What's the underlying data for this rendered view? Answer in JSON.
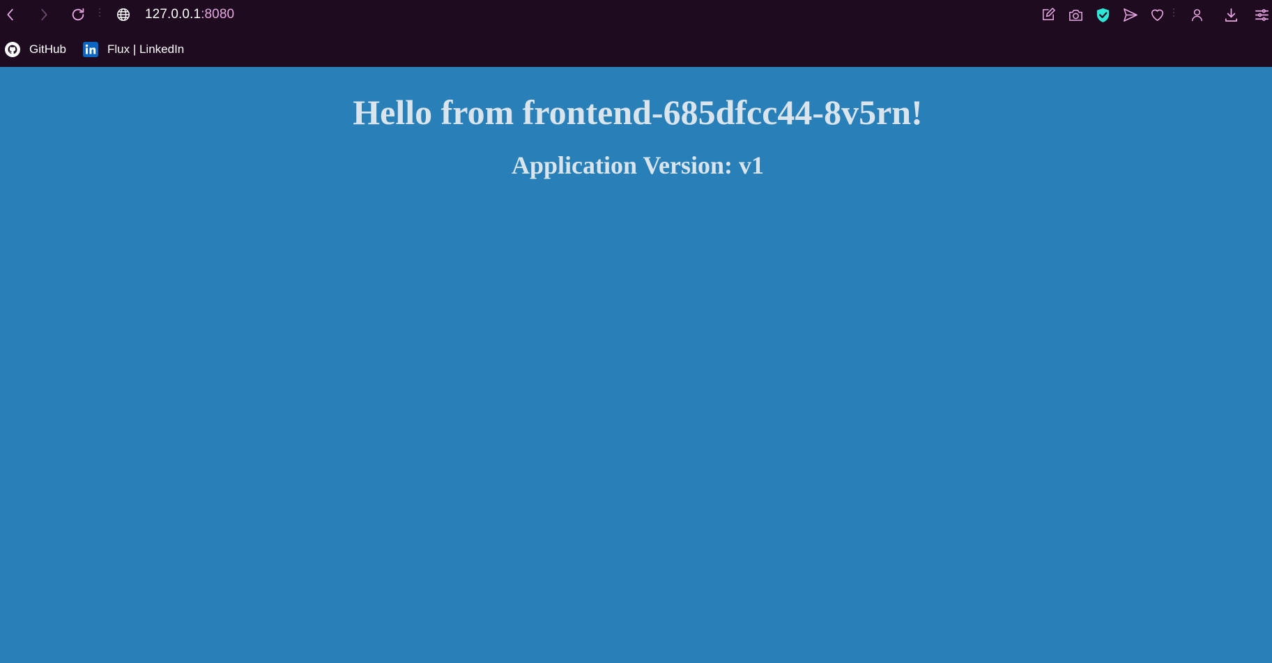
{
  "browser": {
    "url_host": "127.0.0.1",
    "url_port": ":8080",
    "bookmarks": [
      {
        "label": "GitHub",
        "icon": "github-icon"
      },
      {
        "label": "Flux | LinkedIn",
        "icon": "linkedin-icon"
      }
    ],
    "icons": {
      "back": "back-arrow-icon",
      "forward": "forward-arrow-icon",
      "reload": "reload-icon",
      "site_info": "globe-icon",
      "toolbar": [
        "edit-icon",
        "camera-icon",
        "shield-check-icon",
        "send-icon",
        "heart-icon",
        "profile-icon",
        "download-icon",
        "menu-icon"
      ]
    },
    "colors": {
      "chrome_bg": "#1e0b20",
      "icon": "#e9a8e3",
      "shield": "#2ee6d6",
      "linkedin": "#0a66c2"
    }
  },
  "page": {
    "heading": "Hello from frontend-685dfcc44-8v5rn!",
    "subheading": "Application Version: v1",
    "colors": {
      "background": "#2980b9",
      "text": "#d9e4ec"
    }
  }
}
